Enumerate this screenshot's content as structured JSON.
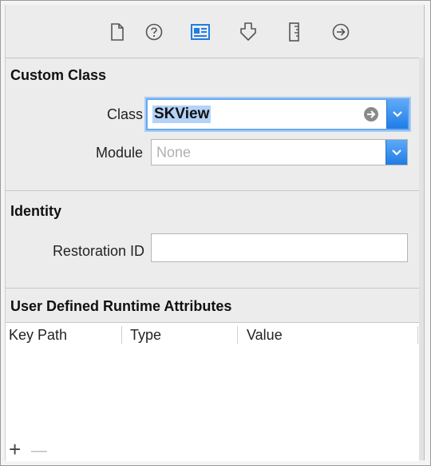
{
  "toolbar": {
    "tabs": [
      {
        "icon": "file-icon"
      },
      {
        "icon": "help-icon"
      },
      {
        "icon": "identity-icon",
        "active": true
      },
      {
        "icon": "attributes-icon"
      },
      {
        "icon": "size-icon"
      },
      {
        "icon": "connections-icon"
      }
    ]
  },
  "custom_class": {
    "title": "Custom Class",
    "class_label": "Class",
    "class_value": "SKView",
    "module_label": "Module",
    "module_placeholder": "None"
  },
  "identity": {
    "title": "Identity",
    "restoration_label": "Restoration ID",
    "restoration_value": ""
  },
  "runtime_attributes": {
    "title": "User Defined Runtime Attributes",
    "columns": [
      "Key Path",
      "Type",
      "Value"
    ],
    "add_label": "+",
    "remove_label": "—"
  },
  "colors": {
    "accent": "#1f7de6",
    "selection": "#b3d3f7",
    "placeholder": "#b0b0b0"
  }
}
